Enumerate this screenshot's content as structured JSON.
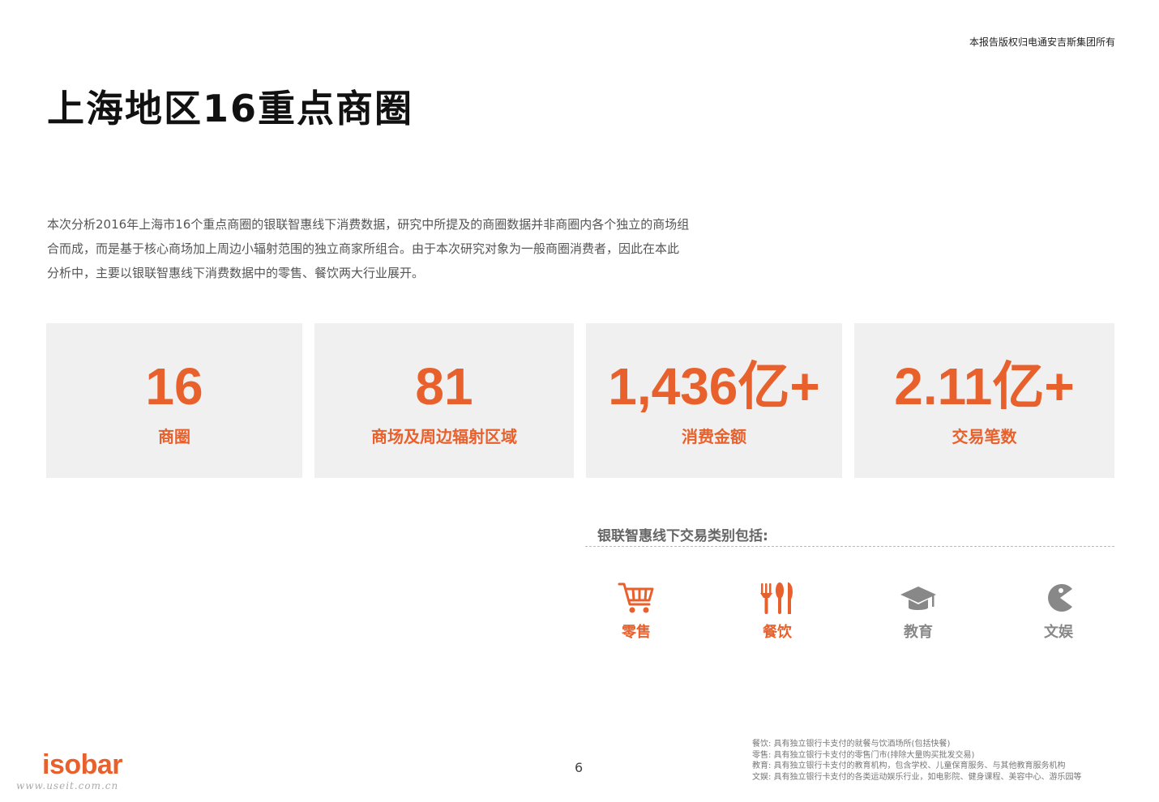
{
  "header": {
    "copyright": "本报告版权归电通安吉斯集团所有",
    "title": "上海地区16重点商圈"
  },
  "intro": {
    "lines": [
      "本次分析2016年上海市16个重点商圈的银联智惠线下消费数据，研究中所提及的商圈数据并非商圈内各个独立的商场组",
      "合而成，而是基于核心商场加上周边小辐射范围的独立商家所组合。由于本次研究对象为一般商圈消费者，因此在本此",
      "分析中，主要以银联智惠线下消费数据中的零售、餐饮两大行业展开。"
    ]
  },
  "stats": [
    {
      "value": "16",
      "label": "商圈"
    },
    {
      "value": "81",
      "label": "商场及周边辐射区域"
    },
    {
      "value": "1,436亿+",
      "label": "消费金额"
    },
    {
      "value": "2.11亿+",
      "label": "交易笔数"
    }
  ],
  "categories": {
    "title": "银联智惠线下交易类别包括:",
    "items": [
      {
        "icon": "shopping-cart-icon",
        "label": "零售",
        "color": "#e8612c"
      },
      {
        "icon": "utensils-icon",
        "label": "餐饮",
        "color": "#e8612c"
      },
      {
        "icon": "graduation-cap-icon",
        "label": "教育",
        "color": "#888888"
      },
      {
        "icon": "pacman-icon",
        "label": "文娱",
        "color": "#888888"
      }
    ]
  },
  "footer": {
    "logo": "isobar",
    "watermark": "www.useit.com.cn",
    "page_number": "6",
    "notes": [
      "餐饮: 具有独立银行卡支付的就餐与饮酒场所(包括快餐)",
      "零售: 具有独立银行卡支付的零售门市(排除大量购买批发交易)",
      "教育: 具有独立银行卡支付的教育机构，包含学校、儿童保育服务、与其他教育服务机构",
      "文娱: 具有独立银行卡支付的各类运动娱乐行业，如电影院、健身课程、美容中心、游乐园等"
    ]
  },
  "colors": {
    "accent": "#e8612c",
    "card_background": "#f0f0f0",
    "muted_icon": "#888888"
  }
}
